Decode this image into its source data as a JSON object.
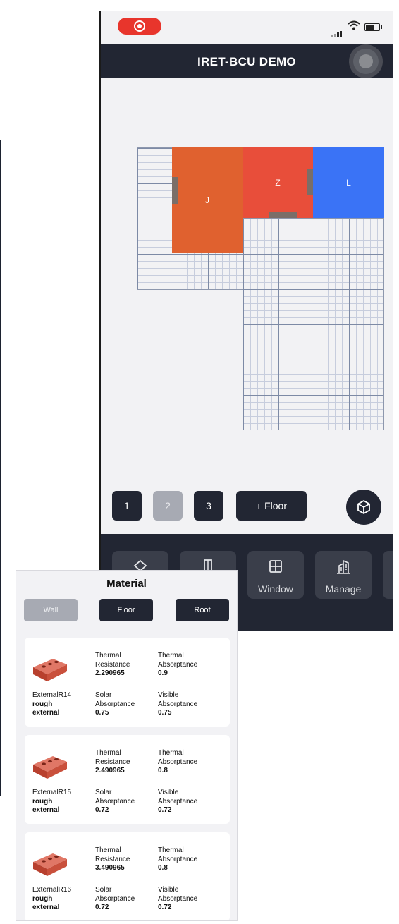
{
  "app": {
    "title": "IRET-BCU DEMO"
  },
  "colors": {
    "header": "#222633",
    "record": "#e8352c",
    "room_j": "#e0612f",
    "room_z": "#e84e3a",
    "room_l": "#3a73f6"
  },
  "plan": {
    "rooms": [
      {
        "label": "J",
        "color": "#e0612f"
      },
      {
        "label": "Z",
        "color": "#e84e3a"
      },
      {
        "label": "L",
        "color": "#3a73f6"
      }
    ]
  },
  "floors": {
    "items": [
      "1",
      "2",
      "3"
    ],
    "selected": "2",
    "add_label": "+ Floor"
  },
  "toolbar": {
    "items": [
      {
        "label": "",
        "icon": "layer-icon"
      },
      {
        "label": "",
        "icon": "door-icon"
      },
      {
        "label": "Window",
        "icon": "window-icon"
      },
      {
        "label": "Manage",
        "icon": "building-icon"
      }
    ]
  },
  "material_panel": {
    "title": "Material",
    "tabs": [
      "Wall",
      "Floor",
      "Roof"
    ],
    "selected_tab": "Wall",
    "labels": {
      "thermal": "Thermal",
      "resistance": "Resistance",
      "absorptance": "Absorptance",
      "solar": "Solar",
      "visible": "Visible"
    },
    "materials": [
      {
        "name": "ExternalR14",
        "line2": "rough",
        "line3": "external",
        "thermal_resistance": "2.290965",
        "thermal_absorptance": "0.9",
        "solar_absorptance": "0.75",
        "visible_absorptance": "0.75"
      },
      {
        "name": "ExternalR15",
        "line2": "rough",
        "line3": "external",
        "thermal_resistance": "2.490965",
        "thermal_absorptance": "0.8",
        "solar_absorptance": "0.72",
        "visible_absorptance": "0.72"
      },
      {
        "name": "ExternalR16",
        "line2": "rough",
        "line3": "external",
        "thermal_resistance": "3.490965",
        "thermal_absorptance": "0.8",
        "solar_absorptance": "0.72",
        "visible_absorptance": "0.72"
      }
    ]
  }
}
